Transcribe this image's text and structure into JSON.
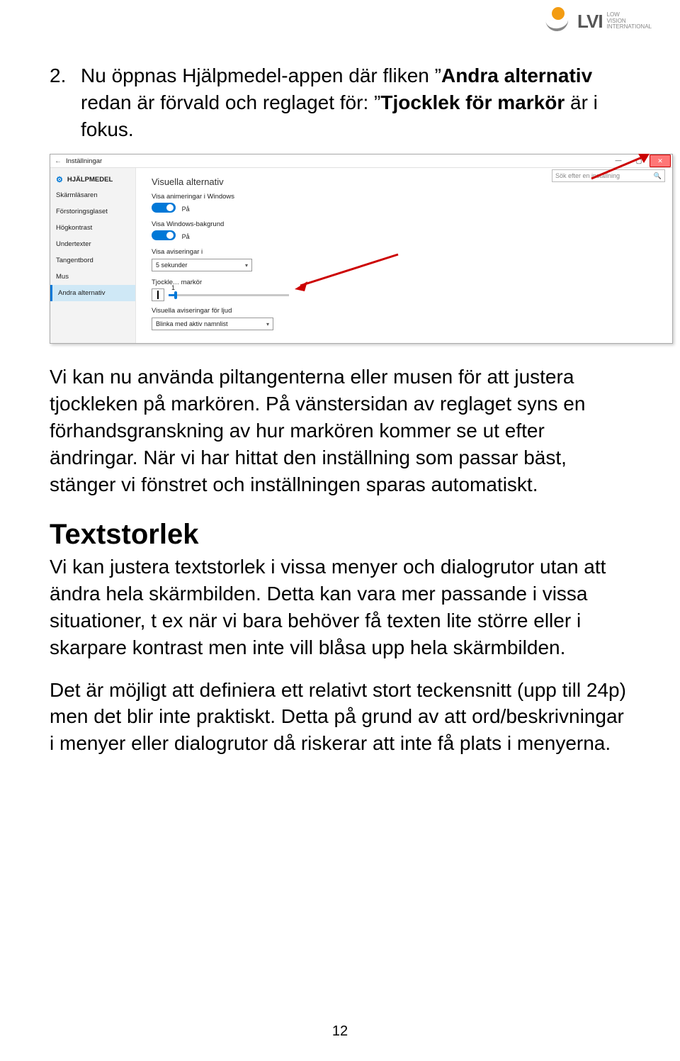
{
  "logo": {
    "big": "LVI",
    "small_line1": "LOW",
    "small_line2": "VISION",
    "small_line3": "INTERNATIONAL"
  },
  "step2": {
    "number": "2.",
    "pre1": "Nu öppnas Hjälpmedel-appen där fliken ",
    "em1_open": "”",
    "em1": "Andra alternativ",
    "mid1": " redan är förvald och reglaget för: ",
    "em2_open": "”",
    "em2": "Tjocklek för markör",
    "post1": " är i fokus."
  },
  "screenshot": {
    "titlebar": {
      "back_icon": "←",
      "title": "Inställningar"
    },
    "win_icons": {
      "min": "—",
      "max": "▢",
      "close": "✕"
    },
    "sidebar": {
      "header": "HJÄLPMEDEL",
      "items": [
        {
          "label": "Skärmläsaren",
          "sel": false
        },
        {
          "label": "Förstoringsglaset",
          "sel": false
        },
        {
          "label": "Högkontrast",
          "sel": false
        },
        {
          "label": "Undertexter",
          "sel": false
        },
        {
          "label": "Tangentbord",
          "sel": false
        },
        {
          "label": "Mus",
          "sel": false
        },
        {
          "label": "Andra alternativ",
          "sel": true
        }
      ]
    },
    "search_placeholder": "Sök efter en inställning",
    "main": {
      "section_title": "Visuella alternativ",
      "anim_label": "Visa animeringar i Windows",
      "on_label_1": "På",
      "bg_label": "Visa Windows-bakgrund",
      "on_label_2": "På",
      "notif_label": "Visa aviseringar i",
      "notif_value": "5 sekunder",
      "thickness_value": "1",
      "thickness_label_pre": "Tjockle",
      "thickness_label_mid": "...",
      "thickness_label_post": "markör",
      "sound_label": "Visuella aviseringar för ljud",
      "sound_value": "Blinka med aktiv namnlist"
    }
  },
  "p1": "Vi kan nu använda piltangenterna eller musen för att justera tjockleken på markören. På vänstersidan av reglaget syns en förhandsgranskning av hur markören kommer se ut efter ändringar. När vi har hittat den inställning som passar bäst, stänger vi fönstret och inställningen sparas automatiskt.",
  "h2": "Textstorlek",
  "p2": "Vi kan justera textstorlek i vissa menyer och dialogrutor utan att ändra hela skärmbilden. Detta kan vara mer passande i vissa situationer, t ex när vi bara behöver få texten lite större eller i skarpare kontrast men inte vill blåsa upp hela skärmbilden.",
  "p3": "Det är möjligt att definiera ett relativt stort teckensnitt (upp till 24p) men det blir inte praktiskt. Detta på grund av att ord/beskrivningar i menyer eller dialogrutor då riskerar att inte få plats i menyerna.",
  "page_number": "12"
}
